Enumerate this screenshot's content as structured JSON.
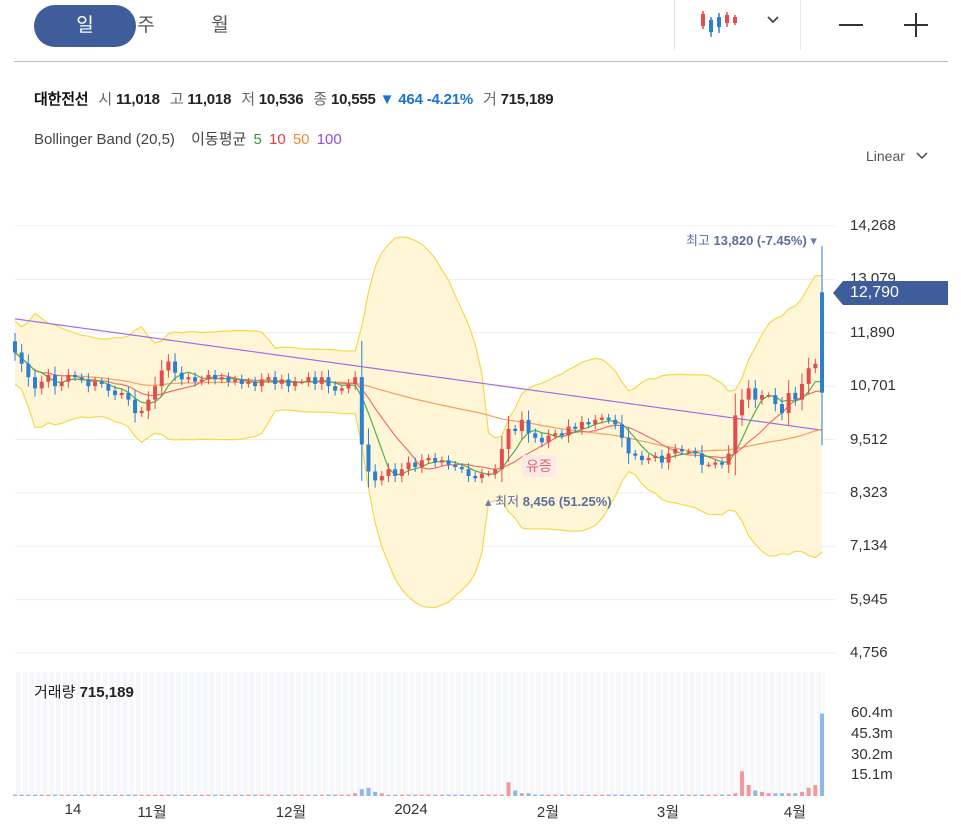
{
  "tabs": [
    {
      "label": "일",
      "active": true
    },
    {
      "label": "주",
      "active": false
    },
    {
      "label": "월",
      "active": false
    }
  ],
  "toolbar": {
    "chart_type_icon": "candlestick-icon",
    "dropdown_icon": "chevron-down-icon",
    "zoom_out_icon": "minus-icon",
    "zoom_in_icon": "plus-icon"
  },
  "stock": {
    "name": "대한전선",
    "open_label": "시",
    "open": "11,018",
    "high_label": "고",
    "high": "11,018",
    "low_label": "저",
    "low": "10,536",
    "close_label": "종",
    "close": "10,555",
    "change_arrow": "▼",
    "change": "464",
    "change_pct": "-4.21%",
    "volume_label": "거",
    "volume": "715,189"
  },
  "indicators": {
    "bollinger": "Bollinger Band (20,5)",
    "ma_label": "이동평균",
    "ma": [
      {
        "label": "5",
        "color": "#2e9e3a"
      },
      {
        "label": "10",
        "color": "#e33d3d"
      },
      {
        "label": "50",
        "color": "#f08a3c"
      },
      {
        "label": "100",
        "color": "#8a4fe0"
      }
    ]
  },
  "scale": {
    "label": "Linear"
  },
  "current_price": "12,790",
  "annotations": {
    "high": {
      "label": "최고",
      "value": "13,820 (-7.45%)"
    },
    "low": {
      "label": "최저",
      "value": "8,456 (51.25%)"
    },
    "event": "유증"
  },
  "volume_panel": {
    "title": "거래량",
    "value": "715,189"
  },
  "colors": {
    "up": "#e34c4c",
    "down": "#2d7fd1",
    "accent": "#3f5d9b",
    "band_fill": "#fff6d8",
    "band_line": "#f4d84a"
  },
  "chart_data": {
    "type": "candlestick",
    "yticks": [
      "14,268",
      "13,079",
      "11,890",
      "10,701",
      "9,512",
      "8,323",
      "7,134",
      "5,945",
      "4,756"
    ],
    "ylim": [
      4756,
      14268
    ],
    "xticks": [
      "14",
      "11월",
      "12월",
      "2024",
      "2월",
      "3월",
      "4월"
    ],
    "volume_ticks": [
      "60.4m",
      "45.3m",
      "30.2m",
      "15.1m"
    ],
    "volume_max": 60.4,
    "series": [
      {
        "name": "open",
        "values": [
          11700,
          11450,
          11200,
          10900,
          10650,
          10800,
          10950,
          10700,
          10800,
          10950,
          10900,
          10850,
          10700,
          10800,
          10750,
          10600,
          10500,
          10550,
          10400,
          10100,
          10150,
          10400,
          10700,
          11050,
          11250,
          11000,
          10850,
          10900,
          10800,
          10850,
          10950,
          10850,
          10900,
          10800,
          10850,
          10750,
          10800,
          10700,
          10850,
          10900,
          10750,
          10850,
          10700,
          10800,
          10800,
          10900,
          10750,
          10900,
          10700,
          10600,
          10650,
          10750,
          10900,
          9400,
          8800,
          8600,
          8700,
          8850,
          8700,
          8850,
          9000,
          8900,
          9050,
          9100,
          9000,
          9050,
          8950,
          8900,
          8850,
          8700,
          8650,
          8750,
          8750,
          8850,
          9300,
          9750,
          9700,
          9950,
          9650,
          9550,
          9450,
          9600,
          9650,
          9600,
          9800,
          9750,
          9900,
          9850,
          9950,
          10000,
          9950,
          9850,
          9550,
          9200,
          9150,
          9050,
          9100,
          9150,
          9000,
          9200,
          9300,
          9250,
          9250,
          9200,
          8950,
          8950,
          9000,
          8950,
          9200,
          10050,
          10400,
          10650,
          10400,
          10500,
          10500,
          10300,
          10100,
          10550,
          10400,
          10750,
          11100,
          12790
        ],
        "note": "daily opens (KRW), approx"
      },
      {
        "name": "close",
        "values": [
          11450,
          11200,
          10900,
          10650,
          10800,
          10950,
          10700,
          10800,
          10950,
          10900,
          10850,
          10700,
          10800,
          10750,
          10600,
          10500,
          10550,
          10400,
          10100,
          10150,
          10400,
          10700,
          11050,
          11250,
          11000,
          10850,
          10900,
          10800,
          10850,
          10950,
          10850,
          10900,
          10800,
          10850,
          10750,
          10800,
          10700,
          10850,
          10900,
          10750,
          10850,
          10700,
          10800,
          10800,
          10900,
          10750,
          10900,
          10700,
          10600,
          10650,
          10750,
          10900,
          9400,
          8800,
          8600,
          8700,
          8850,
          8700,
          8850,
          9000,
          8900,
          9050,
          9100,
          9000,
          9050,
          8950,
          8900,
          8850,
          8700,
          8650,
          8750,
          8750,
          8850,
          9300,
          9750,
          9700,
          9950,
          9650,
          9550,
          9450,
          9600,
          9650,
          9600,
          9800,
          9750,
          9900,
          9850,
          9950,
          10000,
          9950,
          9850,
          9550,
          9200,
          9150,
          9050,
          9100,
          9150,
          9000,
          9200,
          9300,
          9250,
          9250,
          9200,
          8950,
          8950,
          9000,
          8950,
          9200,
          10050,
          10400,
          10650,
          10400,
          10500,
          10500,
          10300,
          10100,
          10550,
          10400,
          10750,
          11100,
          11200,
          10555
        ]
      },
      {
        "name": "volume_m",
        "values": [
          1,
          1,
          1,
          1,
          1,
          1,
          1,
          1,
          1,
          1,
          1,
          1,
          1,
          1,
          1,
          1,
          1,
          1,
          1,
          1,
          1,
          1,
          1,
          1,
          1,
          1,
          1,
          1,
          1,
          1,
          1,
          1,
          1,
          1,
          1,
          1,
          1,
          1,
          1,
          1,
          1,
          1,
          1,
          1,
          1,
          1,
          1,
          1,
          1,
          1,
          1,
          2,
          5,
          6,
          3,
          2,
          1,
          1,
          1,
          1,
          1,
          1,
          1,
          1,
          1,
          1,
          1,
          1,
          1,
          1,
          1,
          1,
          1,
          1,
          10,
          4,
          2,
          2,
          1,
          1,
          1,
          1,
          1,
          1,
          1,
          1,
          1,
          1,
          1,
          1,
          1,
          1,
          1,
          1,
          1,
          1,
          1,
          1,
          1,
          1,
          1,
          1,
          1,
          1,
          1,
          1,
          1,
          1,
          2,
          18,
          8,
          4,
          3,
          2,
          2,
          2,
          2,
          2,
          3,
          6,
          8,
          60
        ]
      }
    ]
  }
}
